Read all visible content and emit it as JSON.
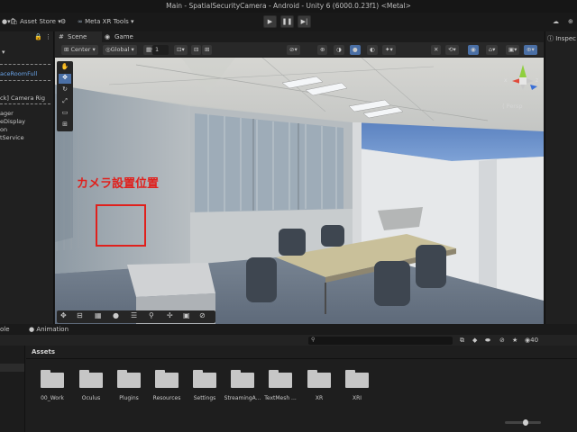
{
  "window": {
    "title": "Main - SpatialSecurityCamera - Android - Unity 6 (6000.0.23f1) <Metal>"
  },
  "toolbar": {
    "asset_store": "Asset Store",
    "meta_xr_tools": "Meta XR Tools"
  },
  "hierarchy": {
    "items": [
      "aceRoomFull",
      "ck] Camera Rig",
      "ager",
      "eDisplay",
      "on",
      "tService"
    ]
  },
  "scene_tabs": {
    "scene": "Scene",
    "game": "Game"
  },
  "scene_toolbar": {
    "pivot": "Center",
    "space": "Global",
    "grid_size": "1"
  },
  "viewport": {
    "annotation": "カメラ設置位置",
    "persp": "Persp",
    "gizmo_x": "x",
    "gizmo_z": "z",
    "annotation_color": "#e0201c"
  },
  "inspector": {
    "tab": "Inspec"
  },
  "bottom": {
    "tabs": {
      "console": "ole",
      "animation": "Animation"
    },
    "assets_header": "Assets",
    "asset_count": "40",
    "folders": [
      "00_Work",
      "Oculus",
      "Plugins",
      "Resources",
      "Settings",
      "StreamingA...",
      "TextMesh ...",
      "XR",
      "XRI"
    ]
  }
}
